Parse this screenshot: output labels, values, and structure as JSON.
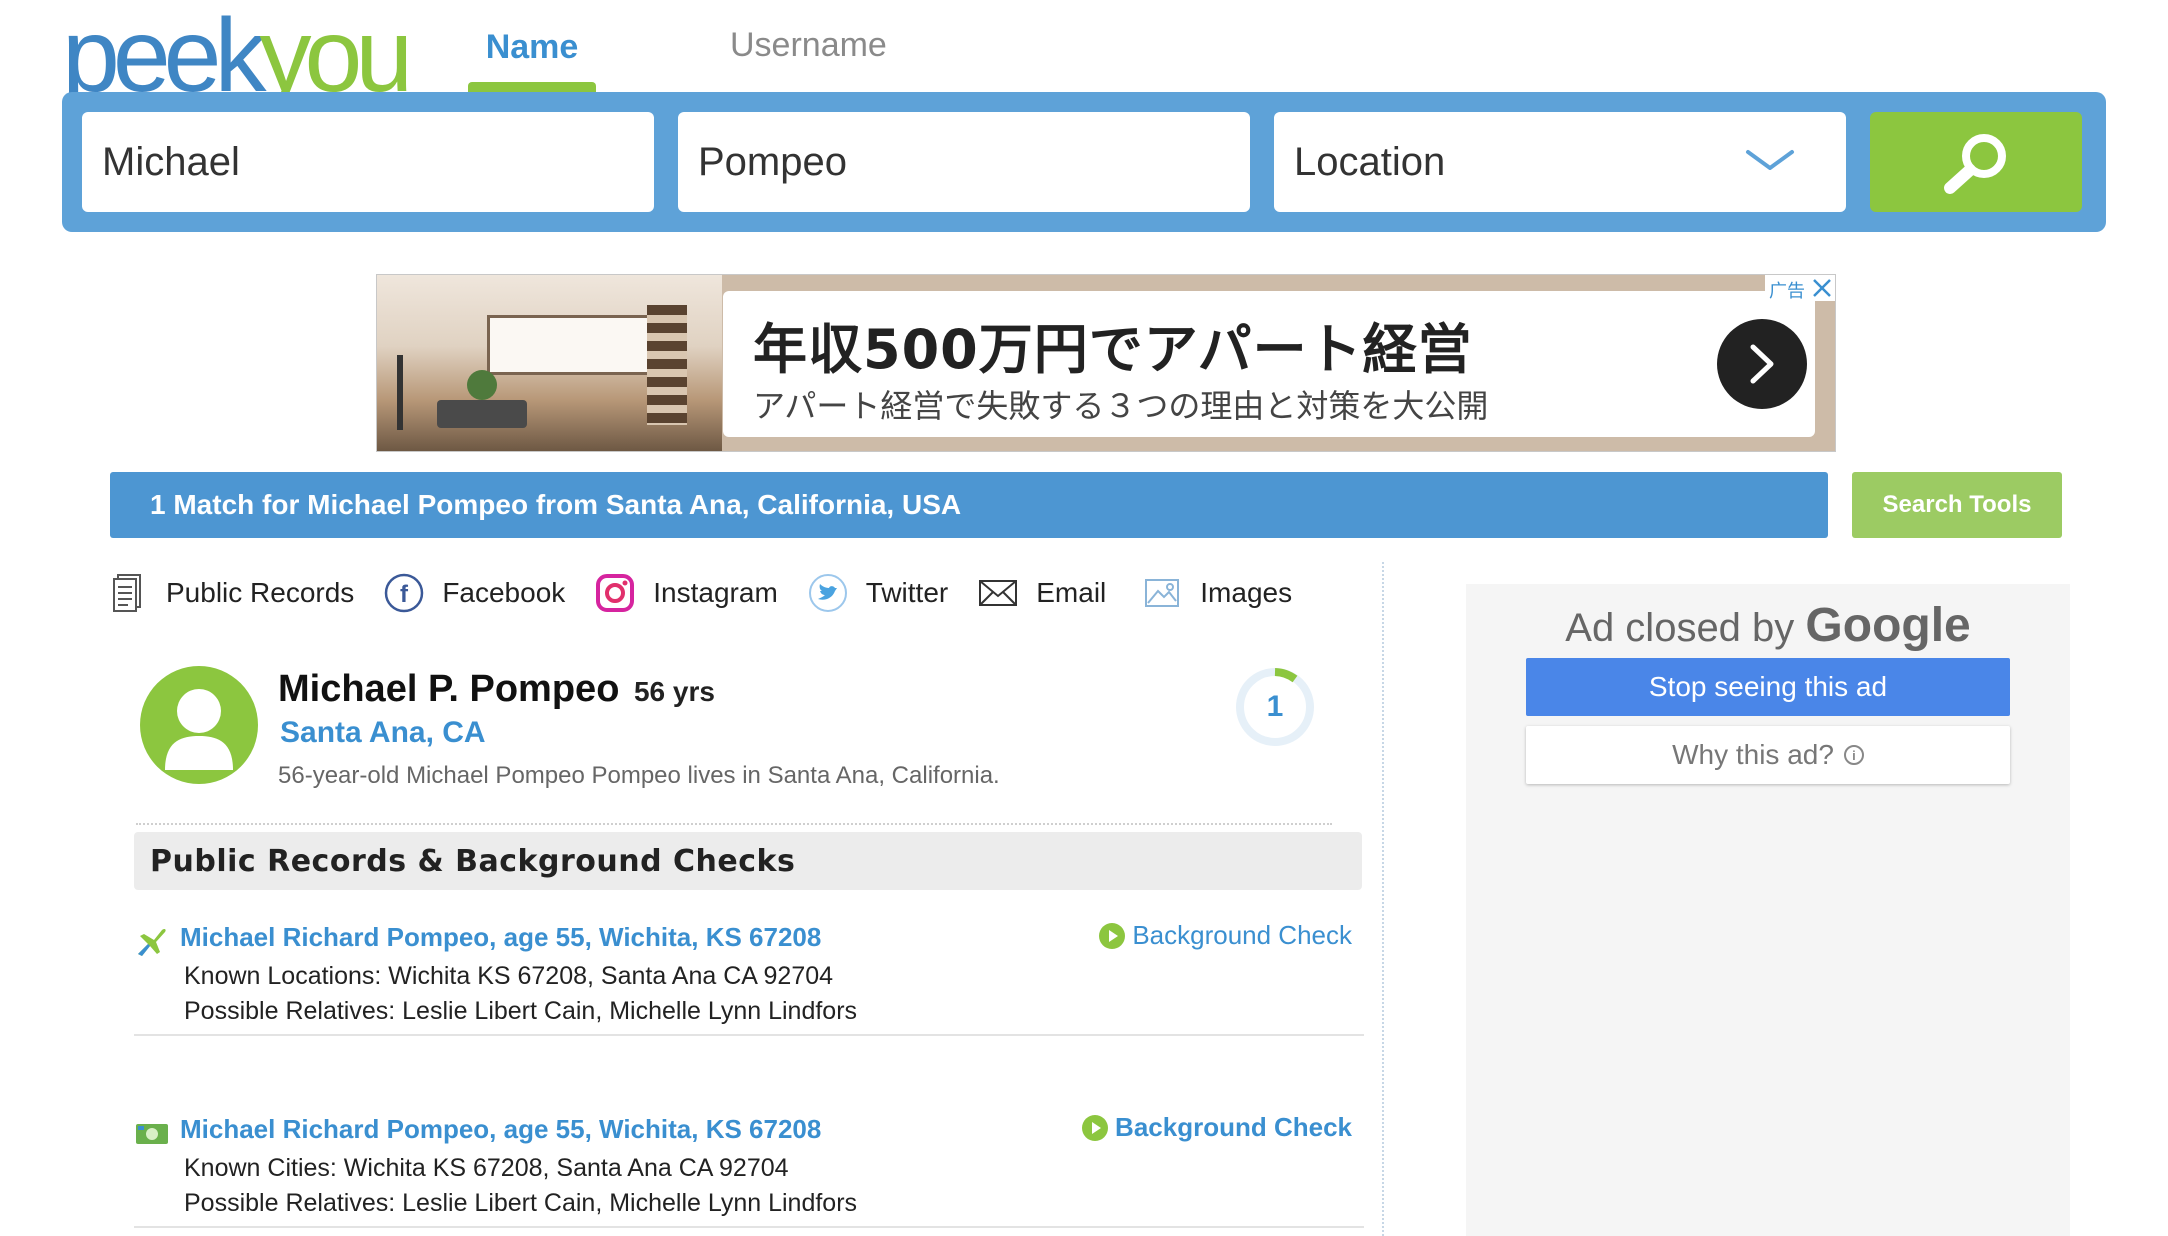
{
  "logo": {
    "part1": "peek",
    "part2": "you"
  },
  "tabs": [
    {
      "label": "Name",
      "active": true
    },
    {
      "label": "Username",
      "active": false
    }
  ],
  "search": {
    "first_name": "Michael",
    "last_name": "Pompeo",
    "location": "Location",
    "button_icon": "search-icon"
  },
  "ad_banner": {
    "headline": "年収500万円でアパート経営",
    "subline": "アパート経営で失敗する３つの理由と対策を大公開",
    "choice_label": "广告"
  },
  "results": {
    "summary": "1 Match for Michael Pompeo from Santa Ana, California, USA",
    "tools_label": "Search Tools"
  },
  "filters": [
    {
      "label": "Public Records",
      "icon": "document-icon"
    },
    {
      "label": "Facebook",
      "icon": "facebook-icon"
    },
    {
      "label": "Instagram",
      "icon": "instagram-icon"
    },
    {
      "label": "Twitter",
      "icon": "twitter-icon"
    },
    {
      "label": "Email",
      "icon": "email-icon"
    },
    {
      "label": "Images",
      "icon": "image-icon"
    }
  ],
  "person": {
    "name": "Michael P. Pompeo",
    "age": "56 yrs",
    "location": "Santa Ana, CA",
    "description": "56-year-old Michael Pompeo Pompeo lives in Santa Ana, California.",
    "count": "1"
  },
  "section_title": "Public Records & Background Checks",
  "records": [
    {
      "title": "Michael Richard Pompeo, age 55, Wichita, KS 67208",
      "line1": "Known Locations: Wichita KS 67208, Santa Ana CA 92704",
      "line2": "Possible Relatives: Leslie Libert Cain, Michelle Lynn Lindfors",
      "action": "Background Check",
      "icon": "plane-icon"
    },
    {
      "title": "Michael Richard Pompeo, age 55, Wichita, KS 67208",
      "line1": "Known Cities: Wichita KS 67208, Santa Ana CA 92704",
      "line2": "Possible Relatives: Leslie Libert Cain, Michelle Lynn Lindfors",
      "action": "Background Check",
      "icon": "money-icon"
    }
  ],
  "side_ad": {
    "closed_prefix": "Ad closed by ",
    "closed_brand": "Google",
    "stop_label": "Stop seeing this ad",
    "why_label": "Why this ad?"
  },
  "colors": {
    "brand_blue": "#3f86c4",
    "brand_green": "#8cc63f",
    "search_bar": "#5ea2d8",
    "results_bar": "#4d96d2",
    "link_blue": "#3a8fd0"
  }
}
